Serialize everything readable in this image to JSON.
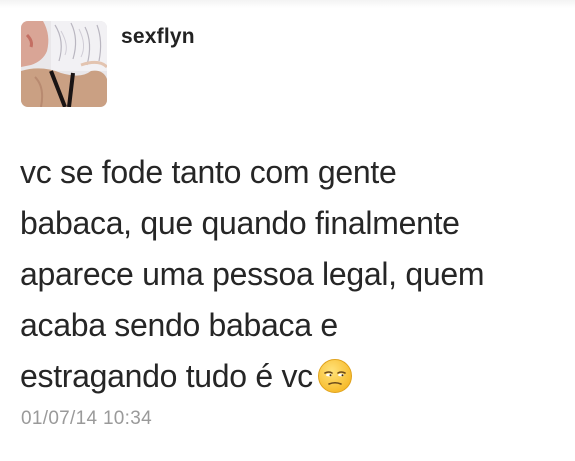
{
  "tweet": {
    "username": "sexflyn",
    "text_lines": [
      "vc se fode tanto com gente",
      "babaca, que quando finalmente",
      "aparece uma pessoa legal, quem",
      "acaba sendo babaca e",
      "estragando tudo é vc"
    ],
    "emoji": "unamused-face-emoji",
    "timestamp": "01/07/14 10:34"
  },
  "colors": {
    "text": "#262626",
    "username": "#222222",
    "timestamp": "#9a9a9a",
    "emoji_face": "#ffcc33"
  }
}
